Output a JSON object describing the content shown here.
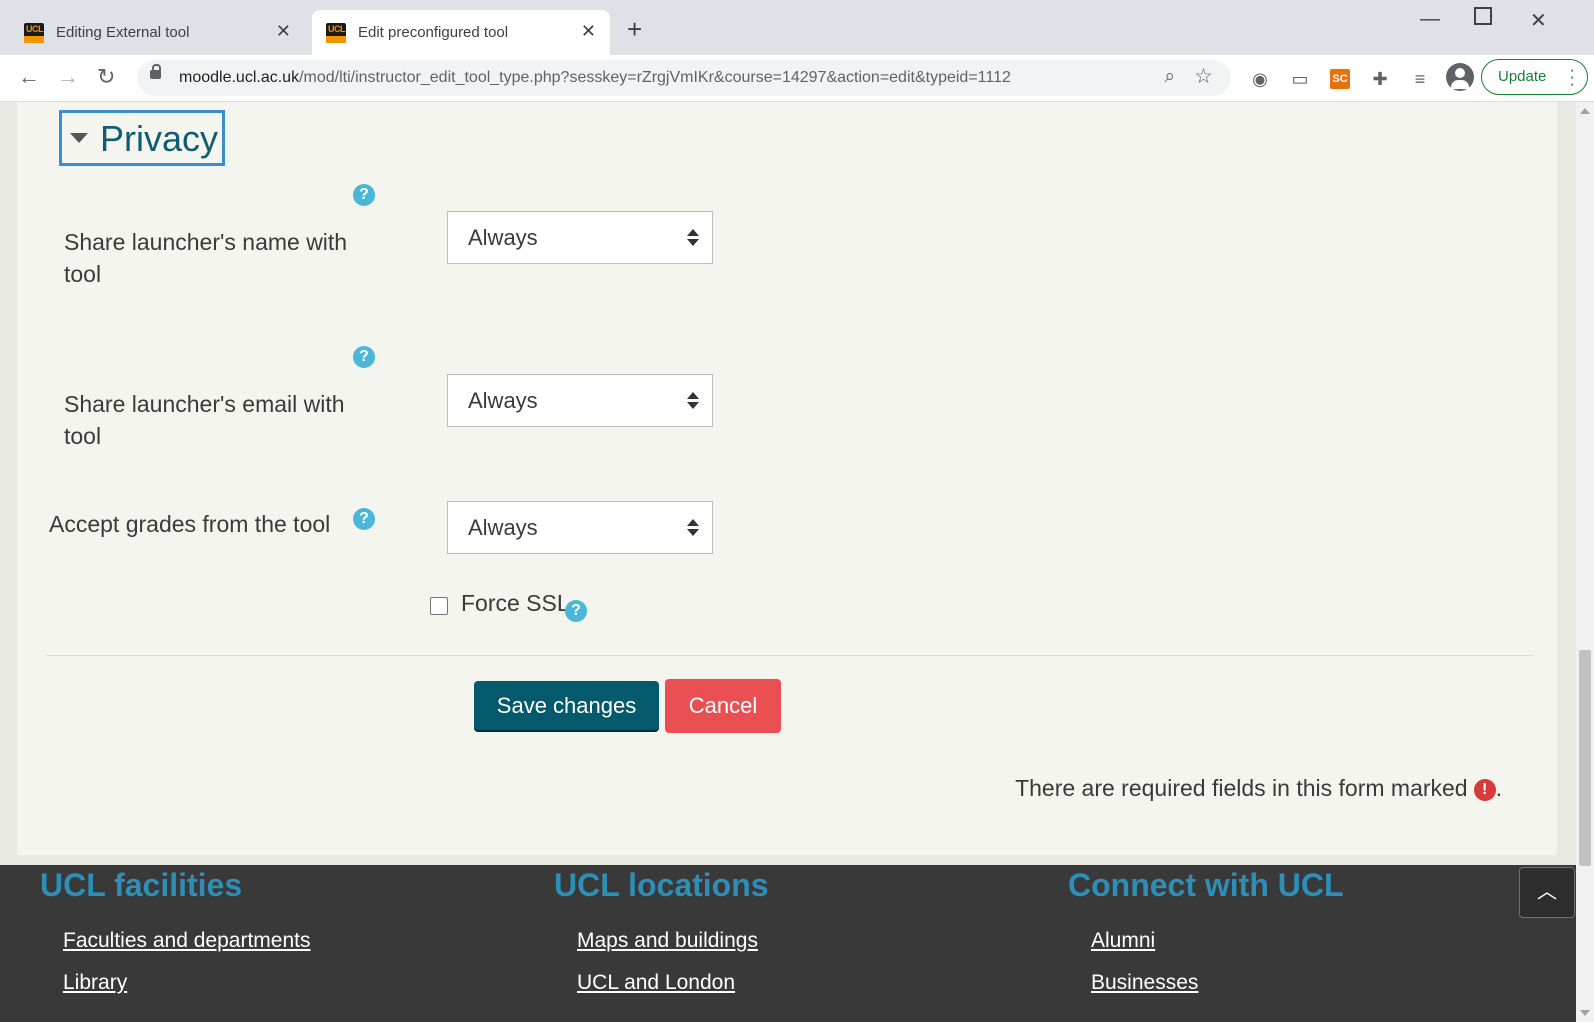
{
  "browser": {
    "tabs": [
      {
        "title": "Editing External tool",
        "favicon": "UCL"
      },
      {
        "title": "Edit preconfigured tool",
        "favicon": "UCL"
      }
    ],
    "url_host": "moodle.ucl.ac.uk",
    "url_path": "/mod/lti/instructor_edit_tool_type.php?sesskey=rZrgjVmIKr&course=14297&action=edit&typeid=1112",
    "update_label": "Update",
    "extension_sc_label": "SC"
  },
  "section": {
    "title": "Privacy",
    "fields": [
      {
        "label_line1": "Share launcher's name with",
        "label_line2": "tool",
        "value": "Always"
      },
      {
        "label_line1": "Share launcher's email with",
        "label_line2": "tool",
        "value": "Always"
      },
      {
        "label_line1": "Accept grades from the tool",
        "label_line2": "",
        "value": "Always"
      }
    ],
    "force_ssl_label": "Force SSL"
  },
  "actions": {
    "save_label": "Save changes",
    "cancel_label": "Cancel"
  },
  "required_note": "There are required fields in this form marked",
  "required_note_suffix": ".",
  "footer": {
    "columns": [
      {
        "heading": "UCL facilities",
        "links": [
          "Faculties and departments",
          "Library"
        ]
      },
      {
        "heading": "UCL locations",
        "links": [
          "Maps and buildings",
          "UCL and London"
        ]
      },
      {
        "heading": "Connect with UCL",
        "links": [
          "Alumni",
          "Businesses"
        ]
      }
    ]
  },
  "colors": {
    "accent": "#105c72",
    "save_button": "#045a6c",
    "cancel_button": "#ea4f52",
    "help_icon": "#4ab6d8",
    "footer_heading": "#2d8fb8"
  }
}
